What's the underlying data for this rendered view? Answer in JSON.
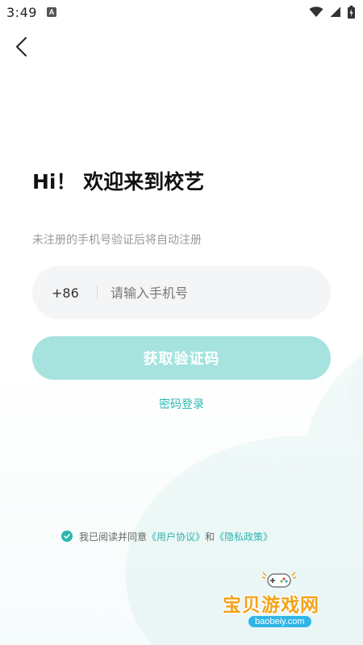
{
  "status_bar": {
    "time": "3:49",
    "notification_icon": "a-icon",
    "icons": [
      "wifi-icon",
      "signal-icon",
      "battery-icon"
    ]
  },
  "nav": {
    "back_icon": "chevron-left-icon"
  },
  "welcome": {
    "title": "Hi！ 欢迎来到校艺",
    "subtitle": "未注册的手机号验证后将自动注册"
  },
  "phone": {
    "country_code": "+86",
    "placeholder": "请输入手机号",
    "value": ""
  },
  "actions": {
    "get_code_label": "获取验证码",
    "password_login_label": "密码登录"
  },
  "agreement": {
    "checked": true,
    "prefix": "我已阅读并同意",
    "user_agreement": "《用户协议》",
    "and": "和",
    "privacy_policy": "《隐私政策》"
  },
  "watermark": {
    "title": "宝贝游戏网",
    "url": "baobeiy.com"
  },
  "colors": {
    "accent": "#2bb6b0",
    "button_disabled": "#a6e3df",
    "input_bg": "#f4f5f6",
    "subtitle": "#9a9a9a"
  }
}
